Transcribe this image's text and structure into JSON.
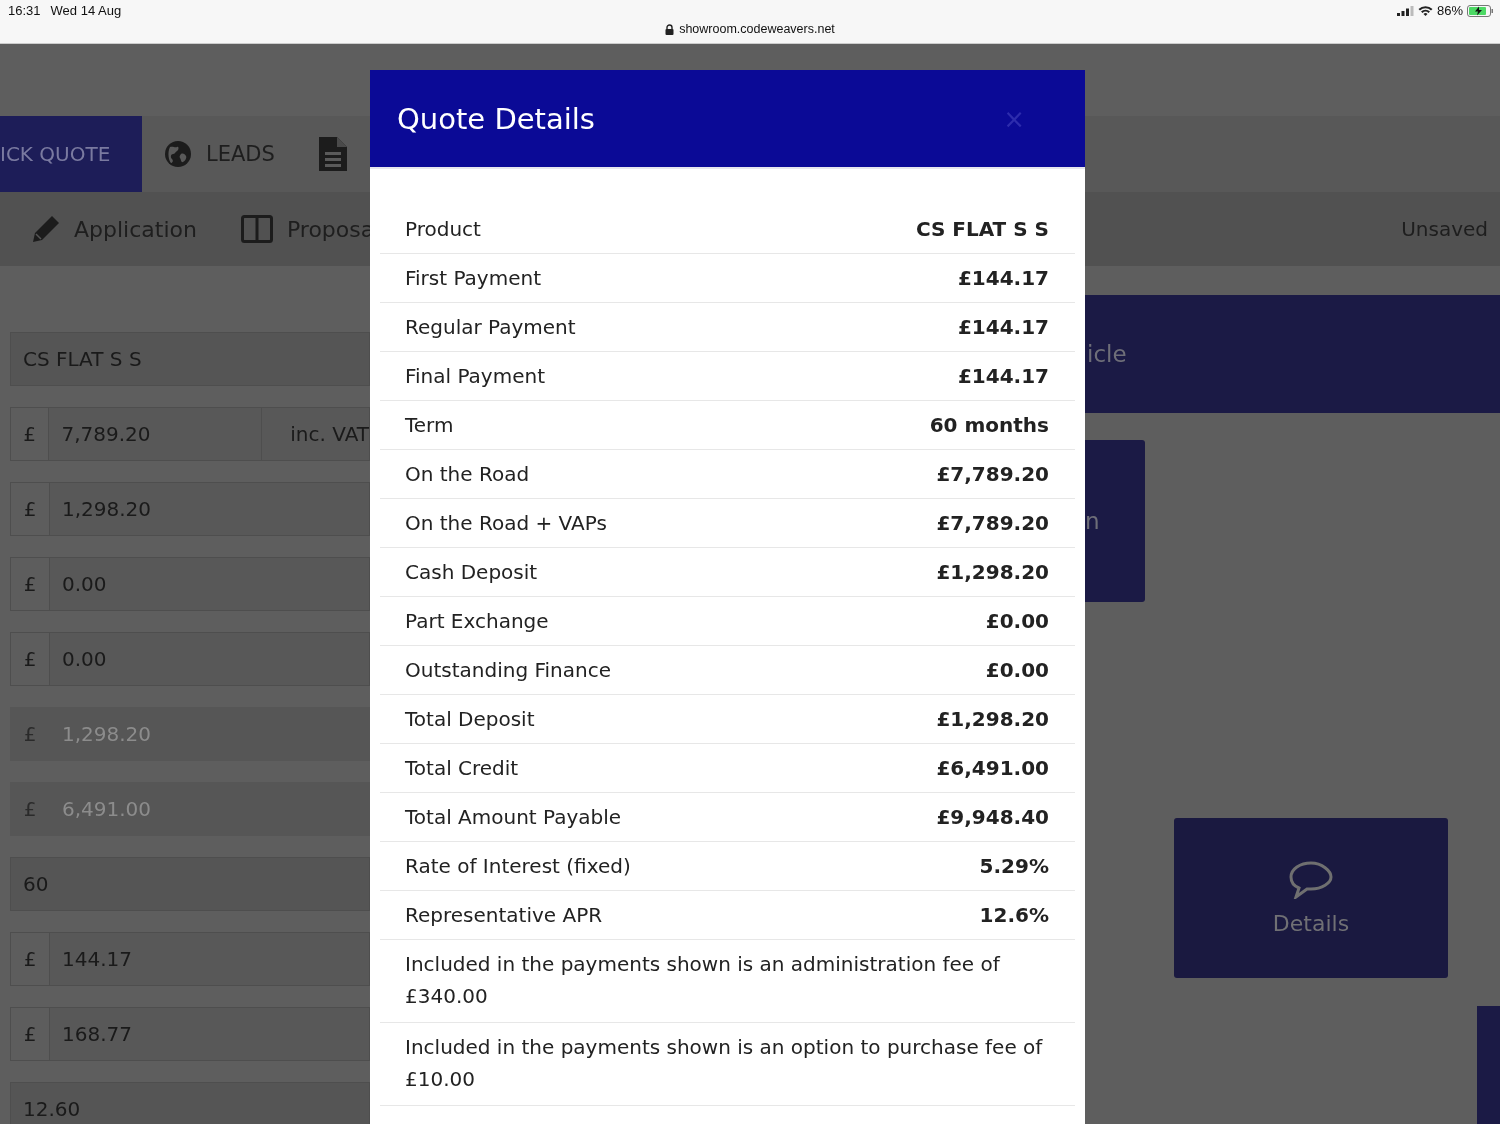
{
  "status_bar": {
    "time": "16:31",
    "date": "Wed 14 Aug",
    "url": "showroom.codeweavers.net",
    "battery": "86%",
    "charging": true
  },
  "nav_tabs": [
    {
      "label": "ICK QUOTE",
      "selected": true
    },
    {
      "label": "LEADS",
      "selected": false
    },
    {
      "selected": false
    }
  ],
  "sub_nav": {
    "items": [
      {
        "label": "Application"
      },
      {
        "label": "Proposa"
      }
    ],
    "status": "Unsaved"
  },
  "fields": [
    {
      "kind": "text",
      "value": "CS FLAT S S",
      "disabled": false
    },
    {
      "kind": "currency",
      "prefix": "£",
      "value": "7,789.20",
      "suffix": "inc. VAT",
      "disabled": false
    },
    {
      "kind": "currency",
      "prefix": "£",
      "value": "1,298.20",
      "disabled": false
    },
    {
      "kind": "currency",
      "prefix": "£",
      "value": "0.00",
      "disabled": false
    },
    {
      "kind": "currency",
      "prefix": "£",
      "value": "0.00",
      "disabled": false
    },
    {
      "kind": "currency",
      "prefix": "£",
      "value": "1,298.20",
      "disabled": true
    },
    {
      "kind": "currency",
      "prefix": "£",
      "value": "6,491.00",
      "disabled": true
    },
    {
      "kind": "text",
      "value": "60",
      "disabled": false
    },
    {
      "kind": "currency",
      "prefix": "£",
      "value": "144.17",
      "disabled": false
    },
    {
      "kind": "currency",
      "prefix": "£",
      "value": "168.77",
      "disabled": false
    },
    {
      "kind": "text",
      "value": "12.60",
      "disabled": false
    }
  ],
  "side_panels": [
    {
      "kind": "banner",
      "label": "icle"
    },
    {
      "kind": "tile",
      "label": "n"
    },
    {
      "kind": "action",
      "label": "Details"
    },
    {
      "kind": "tile"
    }
  ],
  "modal": {
    "title": "Quote Details",
    "close": "×",
    "rows": [
      {
        "label": "Product",
        "value": "CS FLAT S S"
      },
      {
        "label": "First Payment",
        "value": "£144.17"
      },
      {
        "label": "Regular Payment",
        "value": "£144.17"
      },
      {
        "label": "Final Payment",
        "value": "£144.17"
      },
      {
        "label": "Term",
        "value": "60 months"
      },
      {
        "label": "On the Road",
        "value": "£7,789.20"
      },
      {
        "label": "On the Road + VAPs",
        "value": "£7,789.20"
      },
      {
        "label": "Cash Deposit",
        "value": "£1,298.20"
      },
      {
        "label": "Part Exchange",
        "value": "£0.00"
      },
      {
        "label": "Outstanding Finance",
        "value": "£0.00"
      },
      {
        "label": "Total Deposit",
        "value": "£1,298.20"
      },
      {
        "label": "Total Credit",
        "value": "£6,491.00"
      },
      {
        "label": "Total Amount Payable",
        "value": "£9,948.40"
      },
      {
        "label": "Rate of Interest (fixed)",
        "value": "5.29%"
      },
      {
        "label": "Representative APR",
        "value": "12.6%"
      }
    ],
    "notes": [
      "Included in the payments shown is an administration fee of £340.00",
      "Included in the payments shown is an option to purchase fee of £10.00"
    ]
  }
}
